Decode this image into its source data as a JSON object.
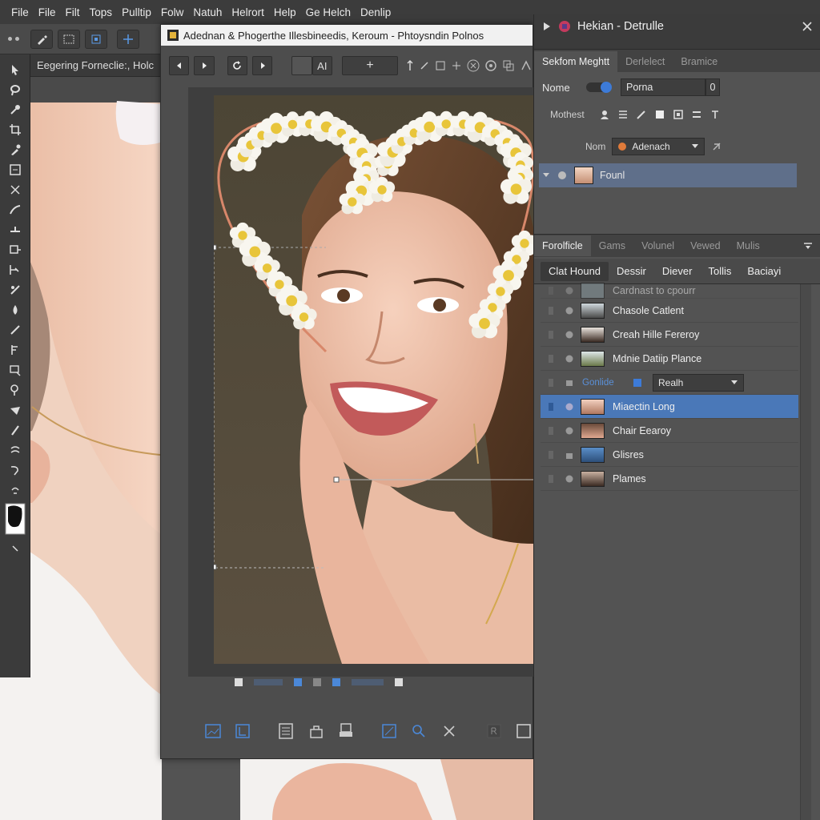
{
  "menubar": {
    "items": [
      "File",
      "File",
      "Filt",
      "Tops",
      "Pulltip",
      "Folw",
      "Natuh",
      "Helrort",
      "Help",
      "Ge Helch",
      "Denlip"
    ]
  },
  "options_bar": {
    "tools": [
      "brush-icon",
      "selection-icon",
      "transform-icon",
      "grid-icon"
    ]
  },
  "background_doc": {
    "tab_label": "Eegering Forneclie:, Holc"
  },
  "document": {
    "title": "Adednan & Phogerthe Illesbineedis, Keroum - Phtoysndin Polnos",
    "nav": {
      "text_tool_label": "AI",
      "add_label": "+"
    }
  },
  "right_panel": {
    "title": "Hekian - Detrulle",
    "top_tabs": [
      "Sekfom Meghtt",
      "Derlelect",
      "Bramice"
    ],
    "properties": {
      "name_label": "Nome",
      "name_value": "Porna",
      "number_value": "0",
      "method_label": "Mothest",
      "form_label": "Nom",
      "form_value": "Adenach",
      "layer_label": "Founl"
    },
    "panel_tabs": [
      "Forolficle",
      "Gams",
      "Volunel",
      "Vewed",
      "Mulis"
    ],
    "layer_tabs": [
      "Clat Hound",
      "Dessir",
      "Diever",
      "Tollis",
      "Baciayi"
    ],
    "layers": [
      {
        "name": "Cardnast to cpourr",
        "selected": false,
        "faded": true
      },
      {
        "name": "Chasole Catlent",
        "selected": false
      },
      {
        "name": "Creah Hille Fereroy",
        "selected": false
      },
      {
        "name": "Mdnie Datiip Plance",
        "selected": false
      }
    ],
    "blend": {
      "label": "Gonlide",
      "value": "Realh"
    },
    "layers2": [
      {
        "name": "Miaectin Long",
        "selected": true
      },
      {
        "name": "Chair Eearoy",
        "selected": false
      },
      {
        "name": "Glisres",
        "selected": false
      },
      {
        "name": "Plames",
        "selected": false
      }
    ]
  },
  "colors": {
    "accent": "#4a78b8",
    "panel": "#535353",
    "dark": "#3b3b3b"
  }
}
